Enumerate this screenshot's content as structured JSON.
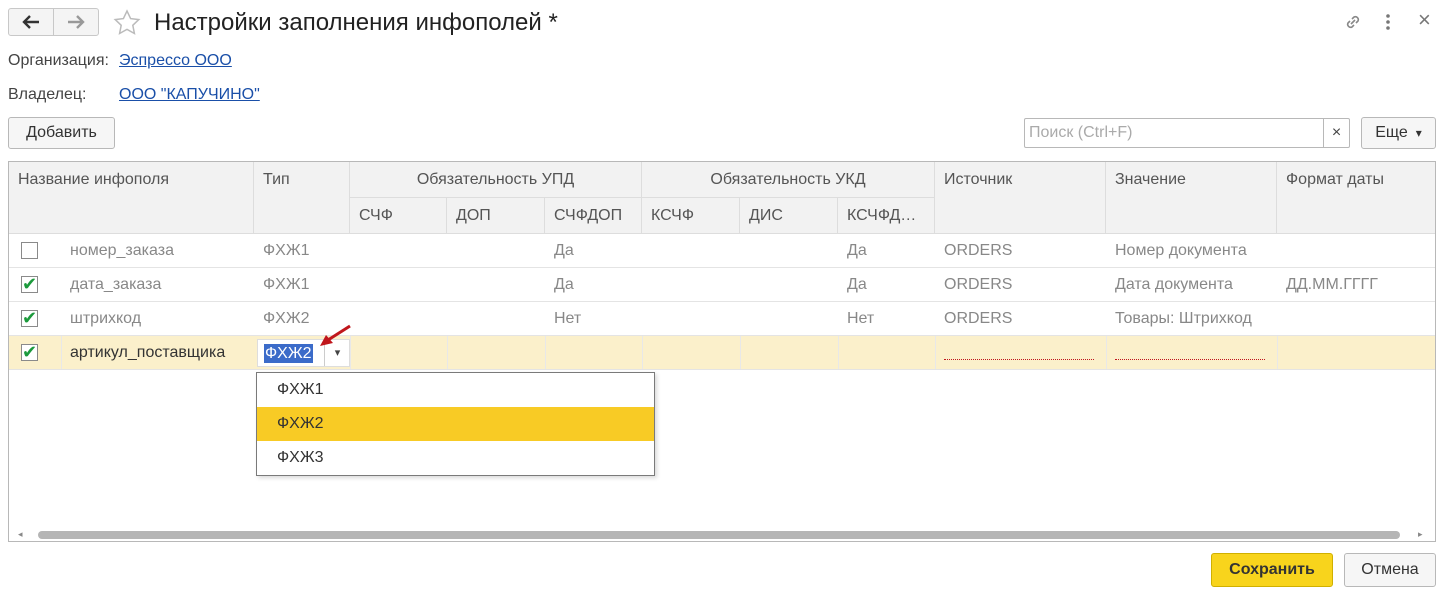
{
  "header": {
    "title": "Настройки заполнения инфополей *",
    "back_icon": "arrow-left-icon",
    "forward_icon": "arrow-right-icon",
    "favorite_icon": "star-icon",
    "link_icon": "link-icon",
    "menu_icon": "more-vertical-icon",
    "close_label": "×"
  },
  "fields": {
    "organization_label": "Организация:",
    "organization_value": "Эспрессо ООО",
    "owner_label": "Владелец:",
    "owner_value": "ООО \"КАПУЧИНО\""
  },
  "toolbar": {
    "add_label": "Добавить",
    "search_placeholder": "Поиск (Ctrl+F)",
    "search_clear": "×",
    "more_label": "Еще",
    "more_arrow": "▾"
  },
  "table": {
    "columns": {
      "name": "Название инфополя",
      "type": "Тип",
      "upd_group": "Обязательность УПД",
      "upd_sf": "СЧФ",
      "upd_dop": "ДОП",
      "upd_sfdop": "СЧФДОП",
      "ukd_group": "Обязательность УКД",
      "ukd_ksf": "КСЧФ",
      "ukd_dis": "ДИС",
      "ukd_ksfdis": "КСЧФД…",
      "source": "Источник",
      "value": "Значение",
      "date_format": "Формат даты"
    },
    "rows": [
      {
        "checked": false,
        "name": "номер_заказа",
        "type": "ФХЖ1",
        "upd_sfdop": "Да",
        "ukd_ksfdis": "Да",
        "source": "ORDERS",
        "value": "Номер документа",
        "date_format": ""
      },
      {
        "checked": true,
        "name": "дата_заказа",
        "type": "ФХЖ1",
        "upd_sfdop": "Да",
        "ukd_ksfdis": "Да",
        "source": "ORDERS",
        "value": "Дата документа",
        "date_format": "ДД.ММ.ГГГГ"
      },
      {
        "checked": true,
        "name": "штрихкод",
        "type": "ФХЖ2",
        "upd_sfdop": "Нет",
        "ukd_ksfdis": "Нет",
        "source": "ORDERS",
        "value": "Товары: Штрихкод",
        "date_format": ""
      },
      {
        "checked": true,
        "name": "артикул_поставщика",
        "type": "ФХЖ2",
        "upd_sfdop": "",
        "ukd_ksfdis": "",
        "source": "",
        "value": "",
        "date_format": ""
      }
    ],
    "checkmark": "✔"
  },
  "dropdown": {
    "options": [
      "ФХЖ1",
      "ФХЖ2",
      "ФХЖ3"
    ],
    "selected": "ФХЖ2",
    "arrow": "▾"
  },
  "footer": {
    "save_label": "Сохранить",
    "cancel_label": "Отмена"
  },
  "colors": {
    "accent_yellow": "#f8cb25",
    "selected_row": "#fbf0cb",
    "link_blue": "#1a4fa8",
    "check_green": "#1c9a3c",
    "annotation_red": "#c0161c"
  }
}
